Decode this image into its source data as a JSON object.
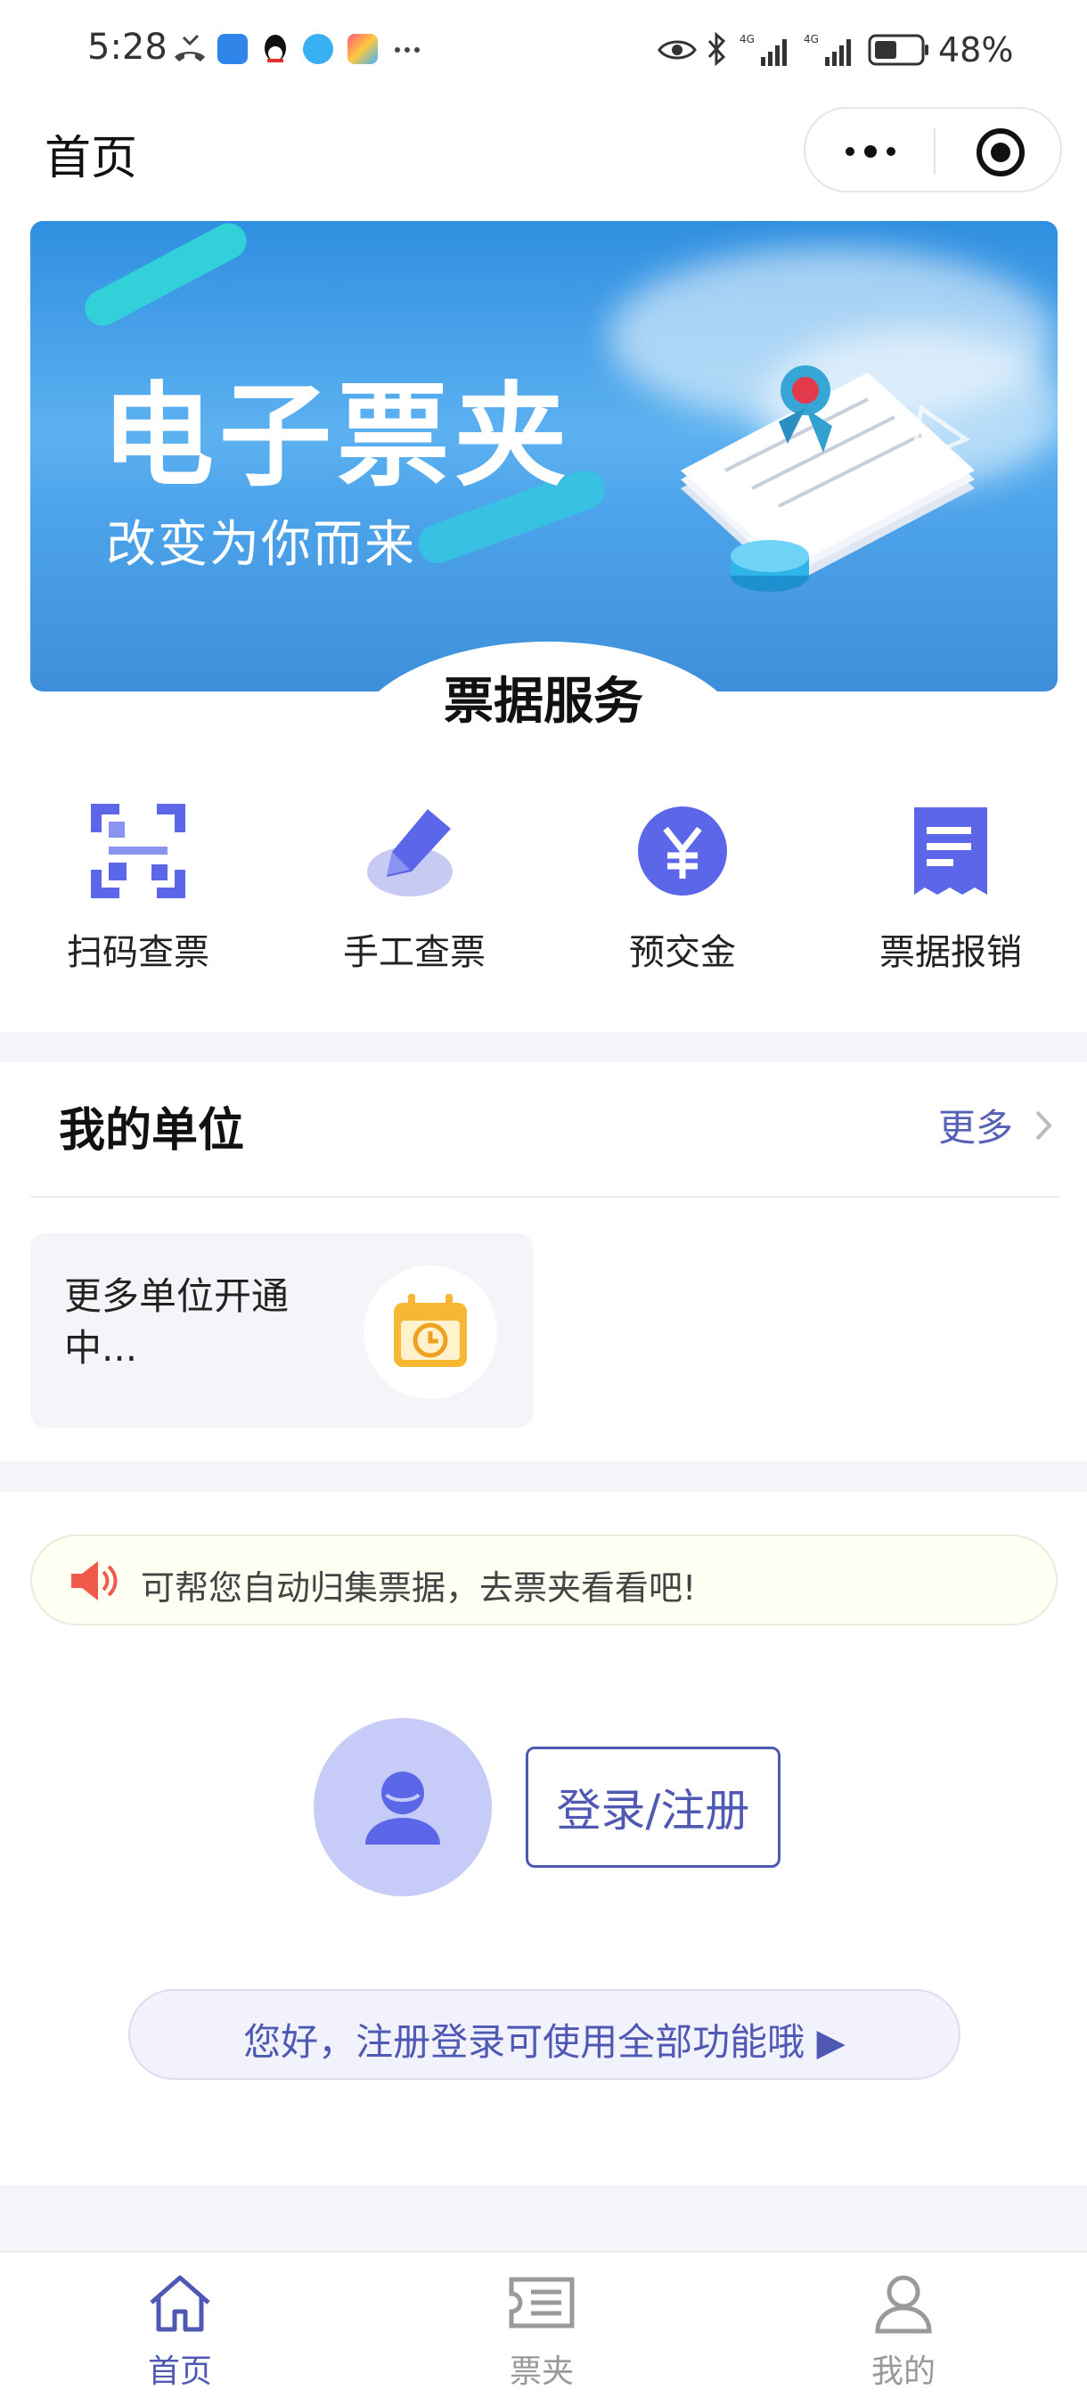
{
  "status_bar": {
    "time": "5:28",
    "battery": "48%",
    "icons": [
      "missed-call-icon",
      "weather-app-icon",
      "qq-icon",
      "browser-icon",
      "app-icon",
      "more-dots-icon",
      "eye-icon",
      "bluetooth-icon",
      "signal-4g-icon",
      "signal-4g-icon",
      "battery-icon"
    ]
  },
  "header": {
    "title": "首页"
  },
  "banner": {
    "title": "电子票夹",
    "subtitle": "改变为你而来"
  },
  "services": {
    "title": "票据服务",
    "items": [
      {
        "label": "扫码查票",
        "icon": "qr-scan-icon"
      },
      {
        "label": "手工查票",
        "icon": "pen-edit-icon"
      },
      {
        "label": "预交金",
        "icon": "yen-coin-icon"
      },
      {
        "label": "票据报销",
        "icon": "receipt-icon"
      }
    ]
  },
  "units": {
    "title": "我的单位",
    "more": "更多",
    "card_text": "更多单位开通中..."
  },
  "notice": {
    "text": "可帮您自动归集票据，去票夹看看吧!"
  },
  "login": {
    "button": "登录/注册",
    "hint": "您好，注册登录可使用全部功能哦 ▶"
  },
  "tabbar": {
    "items": [
      {
        "label": "首页",
        "active": true
      },
      {
        "label": "票夹",
        "active": false
      },
      {
        "label": "我的",
        "active": false
      }
    ]
  },
  "colors": {
    "accent": "#4f59b4",
    "icon_blue": "#5b67e8",
    "gap": "#f4f5f9"
  }
}
